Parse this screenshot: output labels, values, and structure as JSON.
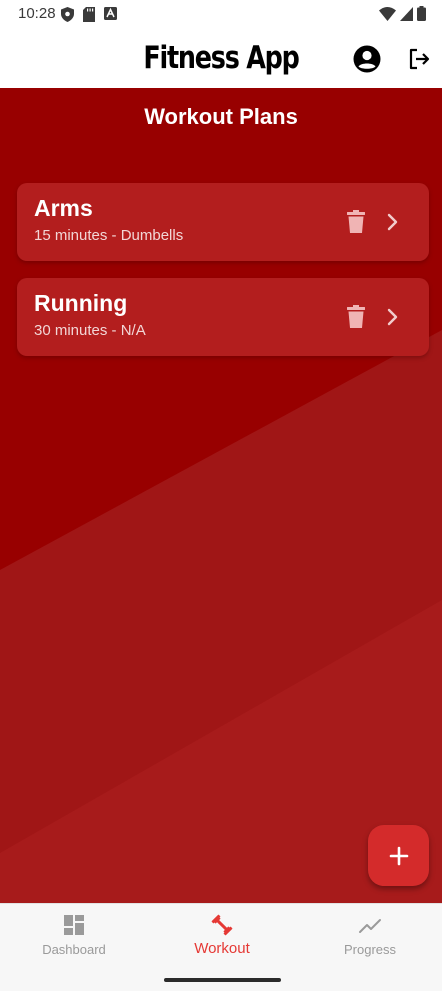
{
  "status_bar": {
    "time": "10:28",
    "left_icons": [
      "shield-icon",
      "sd-card-icon",
      "keyboard-icon"
    ],
    "right_icons": [
      "wifi-icon",
      "cellular-signal-icon",
      "battery-icon"
    ]
  },
  "app_bar": {
    "title": "Fitness App",
    "actions": [
      "account-icon",
      "logout-icon"
    ]
  },
  "main": {
    "section_title": "Workout Plans",
    "plans": [
      {
        "name": "Arms",
        "meta": "15 minutes - Dumbells"
      },
      {
        "name": "Running",
        "meta": "30 minutes - N/A"
      }
    ],
    "fab_icon": "plus-icon"
  },
  "bottom_nav": {
    "items": [
      {
        "label": "Dashboard",
        "icon": "dashboard-icon",
        "active": false
      },
      {
        "label": "Workout",
        "icon": "dumbbell-icon",
        "active": true
      },
      {
        "label": "Progress",
        "icon": "trending-line-icon",
        "active": false
      }
    ]
  },
  "colors": {
    "background": "#980000",
    "card": "#b31e1e",
    "accent": "#e53935",
    "fab": "#d42b2b"
  }
}
